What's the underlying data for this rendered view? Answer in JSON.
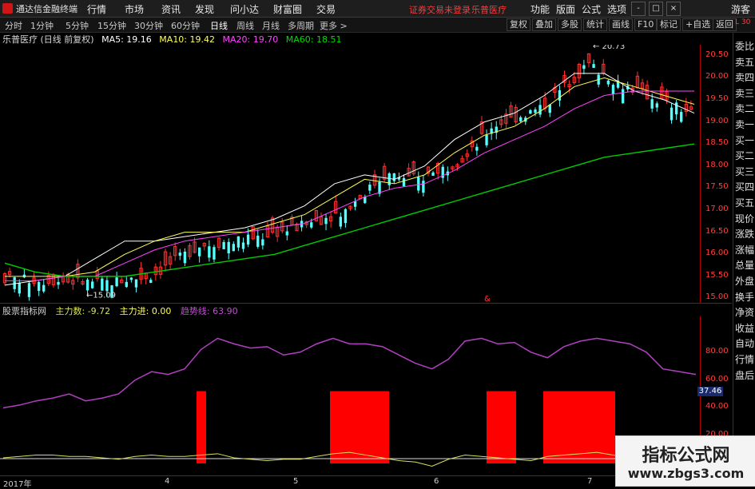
{
  "app": {
    "title": "通达信金融终端"
  },
  "menu": [
    "行情",
    "市场",
    "资讯",
    "发现",
    "问小达",
    "财富圈",
    "交易"
  ],
  "notice": {
    "login": "证券交易未登录",
    "stock": "乐普医疗"
  },
  "right_menu": [
    "功能",
    "版面",
    "公式",
    "选项"
  ],
  "guest_label": "游客",
  "window_buttons": [
    "-",
    "□",
    "×"
  ],
  "periods": [
    "分时",
    "1分钟",
    "5分钟",
    "15分钟",
    "30分钟",
    "60分钟",
    "日线",
    "周线",
    "月线",
    "多周期",
    "更多 >"
  ],
  "active_period": "日线",
  "toolbar": [
    "复权",
    "叠加",
    "多股",
    "统计",
    "画线",
    "F10",
    "标记",
    "+自选",
    "返回"
  ],
  "info": {
    "name": "乐普医疗 (日线 前复权)",
    "ma5": "MA5: 19.16",
    "ma10": "MA10: 19.42",
    "ma20": "MA20: 19.70",
    "ma60": "MA60: 18.51"
  },
  "indicator": {
    "name": "股票指标网",
    "main_count": "主力数: -9.72",
    "main_in": "主力进: 0.00",
    "trend": "趋势线: 63.90"
  },
  "price_axis": [
    "20.50",
    "20.00",
    "19.50",
    "19.00",
    "18.50",
    "18.00",
    "17.50",
    "17.00",
    "16.50",
    "16.00",
    "15.50",
    "15.00"
  ],
  "sub_axis": [
    "80.00",
    "60.00",
    "40.00",
    "20.00"
  ],
  "sub_badge": "37.46",
  "time_labels": [
    "2017年",
    "4",
    "5",
    "6",
    "7"
  ],
  "side_panel": [
    "委比",
    "卖五",
    "卖四",
    "卖三",
    "卖二",
    "卖一",
    "买一",
    "买二",
    "买三",
    "买四",
    "买五",
    "现价",
    "涨跌",
    "涨幅",
    "总量",
    "外盘",
    "换手",
    "净资",
    "收益",
    "自动",
    "行情",
    "盘后"
  ],
  "side_top": "L 30",
  "high_label": "20.73",
  "low_label": "15.09",
  "marker_symbol": "&",
  "watermark": {
    "line1": "指标公式网",
    "line2": "www.zbgs3.com"
  },
  "colors": {
    "up": "#ff3030",
    "down": "#54ffff",
    "ma5": "#ffffff",
    "ma10": "#ffff55",
    "ma20": "#ff44ff",
    "ma60": "#00cc00",
    "trend": "#b040c0",
    "main_line": "#d8e060",
    "main_in_bar": "#ff0000"
  },
  "chart_data": [
    {
      "type": "candlestick",
      "title": "乐普医疗 (日线 前复权)",
      "ylim": [
        14.9,
        20.75
      ],
      "series": [
        {
          "name": "MA5",
          "values": [
            15.3,
            15.4,
            15.5,
            15.9,
            16.3,
            16.3,
            16.4,
            16.5,
            16.6,
            16.8,
            17.1,
            17.6,
            17.8,
            17.7,
            18.0,
            18.6,
            19.0,
            19.2,
            19.6,
            20.1,
            20.1,
            19.7,
            19.5,
            19.2
          ]
        },
        {
          "name": "MA10",
          "values": [
            15.5,
            15.5,
            15.5,
            15.6,
            16.0,
            16.3,
            16.5,
            16.5,
            16.5,
            16.7,
            16.9,
            17.3,
            17.7,
            17.6,
            17.8,
            18.3,
            18.7,
            18.9,
            19.3,
            19.8,
            20.0,
            19.8,
            19.6,
            19.4
          ]
        },
        {
          "name": "MA20",
          "values": [
            15.4,
            15.4,
            15.5,
            15.5,
            15.8,
            16.1,
            16.3,
            16.4,
            16.5,
            16.6,
            16.7,
            17.0,
            17.3,
            17.5,
            17.6,
            17.9,
            18.3,
            18.6,
            18.9,
            19.3,
            19.6,
            19.7,
            19.7,
            19.7
          ]
        },
        {
          "name": "MA60",
          "values": [
            15.8,
            15.6,
            15.5,
            15.5,
            15.5,
            15.6,
            15.7,
            15.8,
            15.9,
            16.0,
            16.2,
            16.4,
            16.6,
            16.8,
            17.0,
            17.2,
            17.4,
            17.6,
            17.8,
            18.0,
            18.2,
            18.3,
            18.4,
            18.5
          ]
        }
      ],
      "annotations": [
        {
          "label": "20.73"
        },
        {
          "label": "15.09"
        }
      ]
    },
    {
      "type": "line",
      "title": "股票指标网",
      "ylim": [
        0,
        100
      ],
      "series": [
        {
          "name": "趋势线",
          "values": [
            40,
            42,
            45,
            47,
            50,
            45,
            47,
            50,
            60,
            66,
            64,
            68,
            82,
            90,
            86,
            83,
            84,
            78,
            80,
            86,
            90,
            86,
            86,
            84,
            78,
            72,
            68,
            75,
            88,
            90,
            86,
            87,
            80,
            76,
            84,
            88,
            90,
            88,
            86,
            80,
            68,
            66,
            64
          ]
        },
        {
          "name": "主力数",
          "values": [
            4,
            5,
            6,
            6,
            5,
            5,
            4,
            3,
            5,
            6,
            5,
            5,
            6,
            7,
            4,
            3,
            2,
            3,
            3,
            5,
            7,
            8,
            6,
            4,
            2,
            1,
            -2,
            3,
            6,
            5,
            4,
            3,
            2,
            5,
            6,
            7,
            8,
            6,
            4,
            3,
            2,
            -3,
            -5
          ]
        }
      ]
    }
  ]
}
